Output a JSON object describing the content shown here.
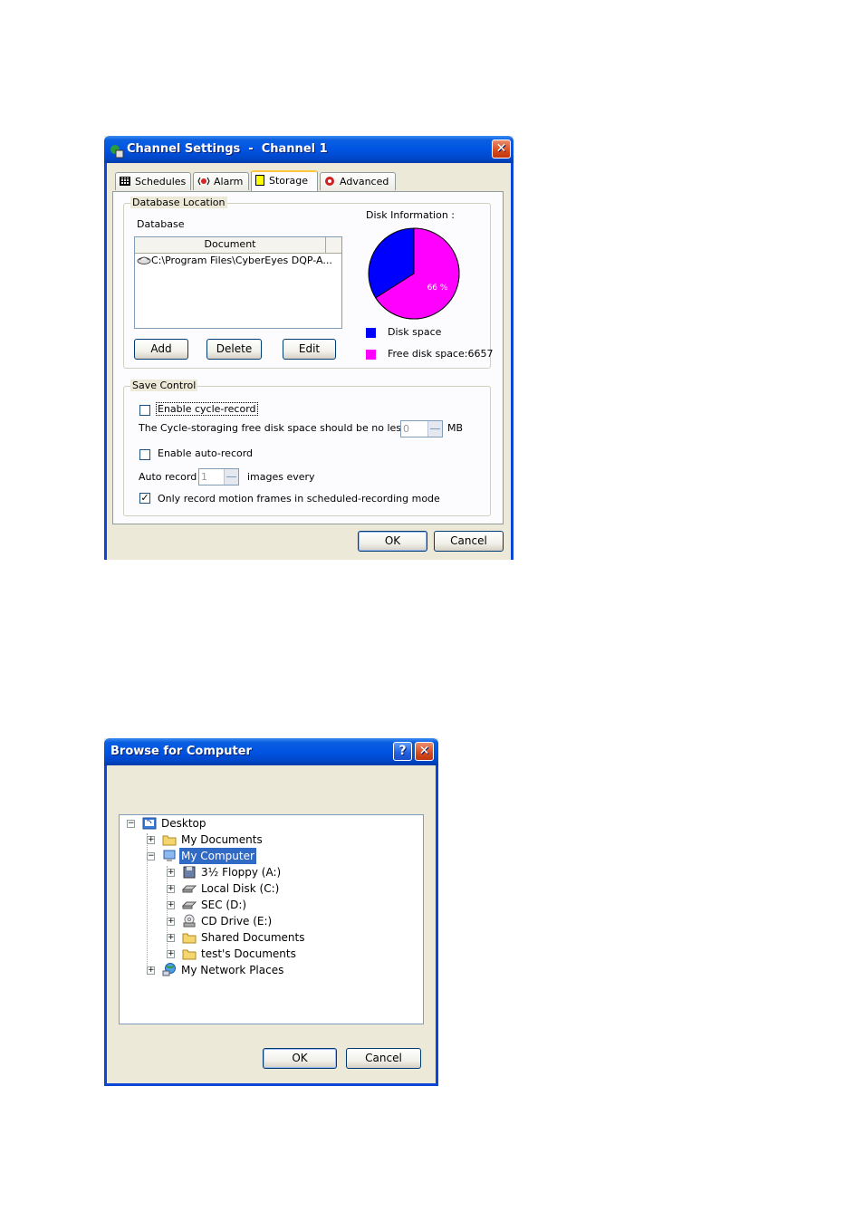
{
  "channel_dialog": {
    "title": "Channel Settings  -  Channel 1",
    "tabs": [
      {
        "label": "Schedules",
        "icon": "grid-icon"
      },
      {
        "label": "Alarm",
        "icon": "alarm-icon"
      },
      {
        "label": "Storage",
        "icon": "storage-icon"
      },
      {
        "label": "Advanced",
        "icon": "advanced-icon"
      }
    ],
    "active_tab": "Storage",
    "db_location": {
      "group_label": "Database Location",
      "database_label": "Database",
      "column_header": "Document",
      "items": [
        "C:\\Program Files\\CyberEyes DQP-A..."
      ],
      "add_label": "Add",
      "delete_label": "Delete",
      "edit_label": "Edit"
    },
    "disk_info": {
      "label": "Disk Information :",
      "legend_disk": "Disk space",
      "legend_free": "Free disk space:6657",
      "percent_label": "66 %",
      "free_fraction": 0.66,
      "colors": {
        "disk": "#0000ff",
        "free": "#ff00ff"
      }
    },
    "save_control": {
      "group_label": "Save Control",
      "cycle_record_label": "Enable cycle-record",
      "cycle_record_checked": false,
      "cycle_text": "The Cycle-storaging free disk space should be no less than",
      "cycle_value": "0",
      "cycle_unit": "MB",
      "auto_record_label": "Enable auto-record",
      "auto_record_checked": false,
      "auto_record_text": "Auto record",
      "auto_record_value": "1",
      "auto_record_suffix": "images every",
      "motion_label": "Only record motion frames in scheduled-recording mode",
      "motion_checked": true
    },
    "ok_label": "OK",
    "cancel_label": "Cancel"
  },
  "browse_dialog": {
    "title": "Browse for Computer",
    "help_label": "?",
    "tree": [
      {
        "label": "Desktop",
        "icon": "desktop-icon"
      },
      {
        "label": "My Documents",
        "icon": "folder-icon"
      },
      {
        "label": "My Computer",
        "icon": "computer-icon",
        "selected": true
      },
      {
        "label": "3½ Floppy (A:)",
        "icon": "floppy-icon"
      },
      {
        "label": "Local Disk (C:)",
        "icon": "disk-icon"
      },
      {
        "label": "SEC (D:)",
        "icon": "disk-icon"
      },
      {
        "label": "CD Drive (E:)",
        "icon": "cd-icon"
      },
      {
        "label": "Shared Documents",
        "icon": "folder-icon"
      },
      {
        "label": "test's Documents",
        "icon": "folder-icon"
      },
      {
        "label": "My Network Places",
        "icon": "network-icon"
      }
    ],
    "ok_label": "OK",
    "cancel_label": "Cancel"
  }
}
